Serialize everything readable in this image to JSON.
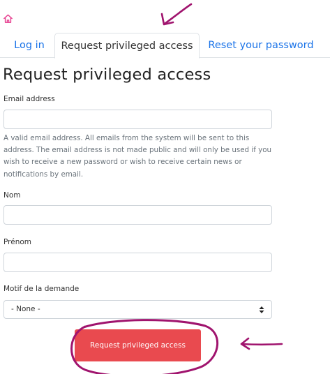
{
  "nav": {
    "home_icon": "home-icon"
  },
  "tabs": [
    {
      "label": "Log in",
      "active": false
    },
    {
      "label": "Request privileged access",
      "active": true
    },
    {
      "label": "Reset your password",
      "active": false
    }
  ],
  "page": {
    "title": "Request privileged access"
  },
  "form": {
    "email": {
      "label": "Email address",
      "value": "",
      "help": "A valid email address. All emails from the system will be sent to this address. The email address is not made public and will only be used if you wish to receive a new password or wish to receive certain news or notifications by email."
    },
    "nom": {
      "label": "Nom",
      "value": ""
    },
    "prenom": {
      "label": "Prénom",
      "value": ""
    },
    "motif": {
      "label": "Motif de la demande",
      "selected": "- None -"
    },
    "submit_label": "Request privileged access"
  },
  "colors": {
    "link": "#1a73e8",
    "home_icon": "#e6398c",
    "button": "#e94a4f",
    "annotation": "#a0146e"
  }
}
